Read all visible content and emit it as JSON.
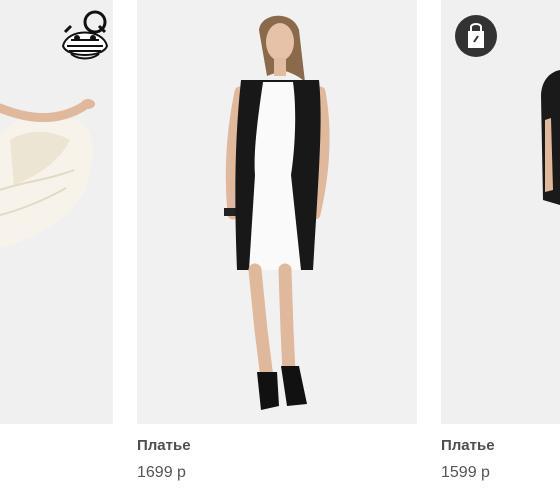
{
  "products": [
    {
      "icon": "cheshire-cat-icon"
    },
    {
      "title": "Платье",
      "price": "1699 р"
    },
    {
      "title": "Платье",
      "price": "1599 р",
      "icon": "shopping-bag-icon"
    }
  ]
}
